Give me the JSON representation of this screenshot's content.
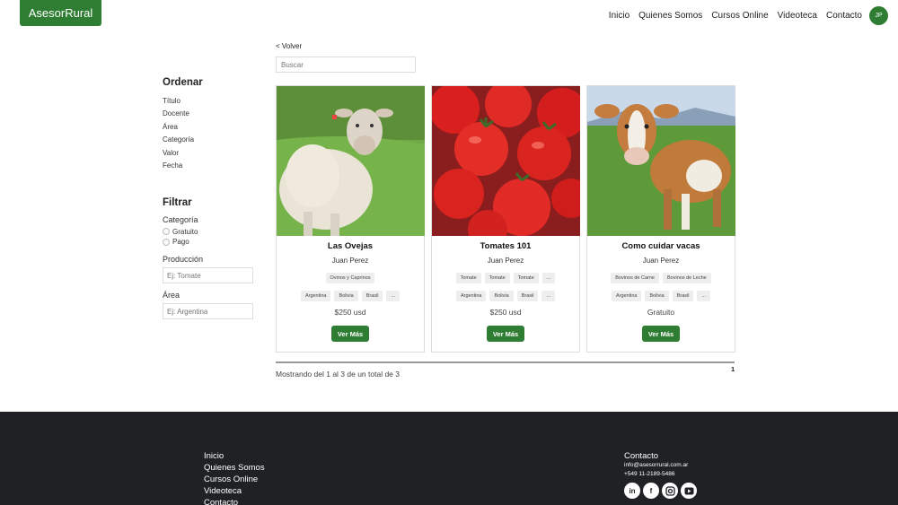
{
  "header": {
    "logo": "AsesorRural",
    "nav": [
      "Inicio",
      "Quienes Somos",
      "Cursos Online",
      "Videoteca",
      "Contacto"
    ],
    "avatar": "JP"
  },
  "back_label": "< Volver",
  "search": {
    "placeholder": "Buscar"
  },
  "sidebar": {
    "sort_title": "Ordenar",
    "sort_items": [
      "Título",
      "Docente",
      "Área",
      "Categoría",
      "Valor",
      "Fecha"
    ],
    "filter_title": "Filtrar",
    "category_label": "Categoría",
    "category_options": [
      "Gratuito",
      "Pago"
    ],
    "production_label": "Producción",
    "production_placeholder": "Ej: Tomate",
    "area_label": "Área",
    "area_placeholder": "Ej: Argentina"
  },
  "cards": [
    {
      "title": "Las Ovejas",
      "author": "Juan Perez",
      "tags": [
        "Ovinos y Caprinos"
      ],
      "regions": [
        "Argentina",
        "Bolivia",
        "Brasil",
        "..."
      ],
      "price": "$250 usd",
      "button": "Ver Más",
      "image": "sheep"
    },
    {
      "title": "Tomates 101",
      "author": "Juan Perez",
      "tags": [
        "Tomate",
        "Tomate",
        "Tomate",
        "..."
      ],
      "regions": [
        "Argentina",
        "Bolivia",
        "Brasil",
        "..."
      ],
      "price": "$250 usd",
      "button": "Ver Más",
      "image": "tomatoes"
    },
    {
      "title": "Como cuidar vacas",
      "author": "Juan Perez",
      "tags": [
        "Bovinos de Carne",
        "Bovinos de Leche"
      ],
      "regions": [
        "Argentina",
        "Bolivia",
        "Brasil",
        "..."
      ],
      "price": "Gratuito",
      "button": "Ver Más",
      "image": "cow"
    }
  ],
  "pagination": {
    "summary": "Mostrando del 1 al 3 de un total de 3",
    "current_page": "1"
  },
  "footer": {
    "links": [
      "Inicio",
      "Quienes Somos",
      "Cursos Online",
      "Videoteca",
      "Contacto"
    ],
    "contact_title": "Contacto",
    "email": "info@asesorrural.com.ar",
    "phone": "+549 11-2189-5486",
    "social": [
      "linkedin-icon",
      "facebook-icon",
      "instagram-icon",
      "youtube-icon"
    ]
  },
  "colors": {
    "brand": "#2e7d32",
    "footer_bg": "#1f2124"
  }
}
